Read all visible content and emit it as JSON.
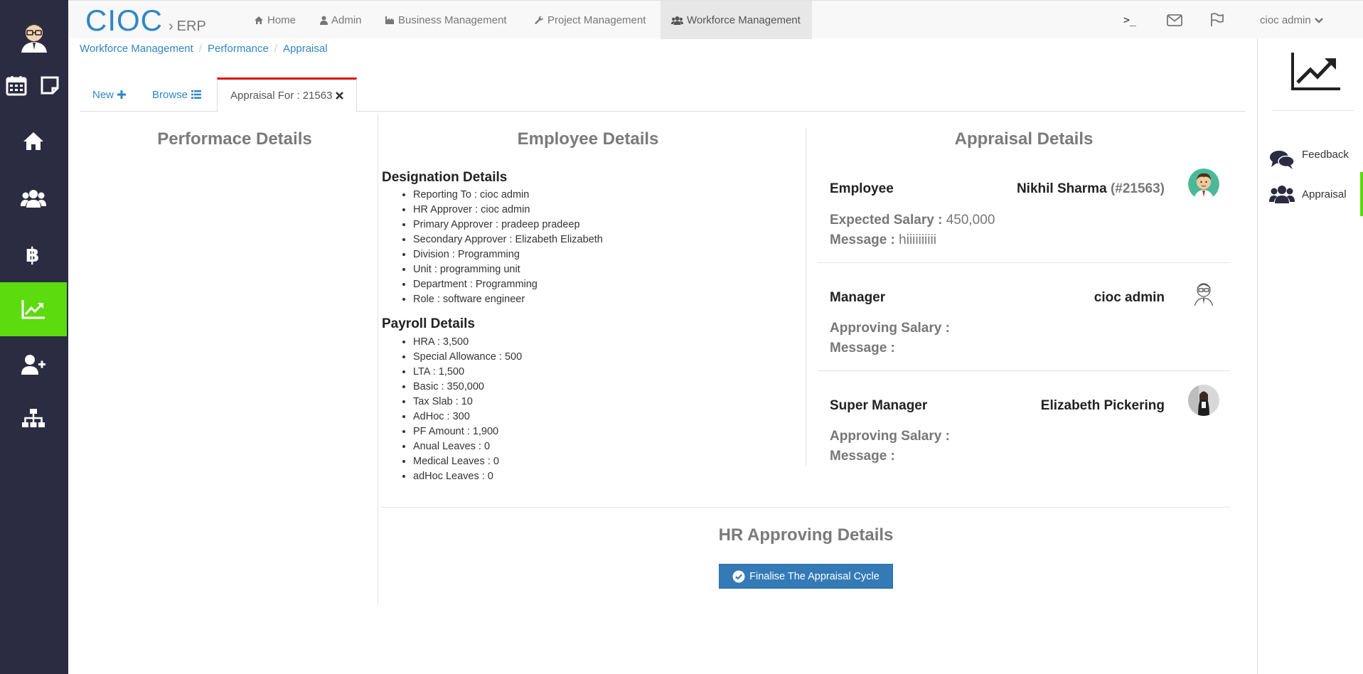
{
  "brand": {
    "main": "CIOC",
    "sep": "›",
    "sub": "ERP"
  },
  "nav": {
    "items": [
      {
        "label": "Home",
        "icon": "home-icon"
      },
      {
        "label": "Admin",
        "icon": "user-icon"
      },
      {
        "label": "Business Management",
        "icon": "industry-icon"
      },
      {
        "label": "Project Management",
        "icon": "wrench-icon"
      },
      {
        "label": "Workforce Management",
        "icon": "users-icon",
        "active": true
      }
    ],
    "terminal_label": ">_",
    "user_label": "cioc admin"
  },
  "breadcrumb": [
    "Workforce Management",
    "Performance",
    "Appraisal"
  ],
  "tabs": {
    "new_label": "New",
    "browse_label": "Browse",
    "active_label": "Appraisal For : 21563"
  },
  "performance": {
    "title": "Performace Details"
  },
  "employee": {
    "title": "Employee Details",
    "designation_title": "Designation Details",
    "designation": [
      "Reporting To : cioc admin",
      "HR Approver : cioc admin",
      "Primary Approver : pradeep pradeep",
      "Secondary Approver : Elizabeth Elizabeth",
      "Division : Programming",
      "Unit : programming unit",
      "Department : Programming",
      "Role : software engineer"
    ],
    "payroll_title": "Payroll Details",
    "payroll": [
      "HRA : 3,500",
      "Special Allowance : 500",
      "LTA : 1,500",
      "Basic : 350,000",
      "Tax Slab : 10",
      "AdHoc : 300",
      "PF Amount : 1,900",
      "Anual Leaves : 0",
      "Medical Leaves : 0",
      "adHoc Leaves : 0"
    ]
  },
  "appraisal": {
    "title": "Appraisal Details",
    "employee": {
      "label": "Employee",
      "name": "Nikhil Sharma",
      "id": "(#21563)",
      "salary_label": "Expected Salary :",
      "salary_value": "450,000",
      "message_label": "Message :",
      "message_value": "hiiiiiiiiii"
    },
    "manager": {
      "label": "Manager",
      "name": "cioc admin",
      "salary_label": "Approving Salary :",
      "message_label": "Message :"
    },
    "super_manager": {
      "label": "Super Manager",
      "name": "Elizabeth Pickering",
      "salary_label": "Approving Salary :",
      "message_label": "Message :"
    }
  },
  "hr": {
    "title": "HR Approving Details",
    "button_label": "Finalise The Appraisal Cycle"
  },
  "right_panel": {
    "items": [
      {
        "label": "Feedback",
        "icon": "comments-icon"
      },
      {
        "label": "Appraisal",
        "icon": "users-icon",
        "active": true
      }
    ]
  },
  "colors": {
    "sidebar_bg": "#2b2b42",
    "sidebar_active": "#5cdb0e",
    "brand_blue": "#2f86c6",
    "tab_active_border": "#e01010",
    "button_primary": "#337ab7"
  }
}
